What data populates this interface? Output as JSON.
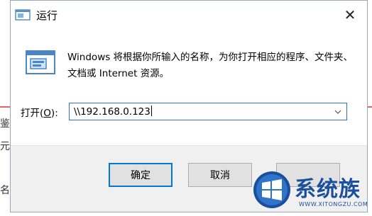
{
  "dialog": {
    "title": "运行",
    "description": "Windows 将根据你所输入的名称，为你打开相应的程序、文件夹、文档或 Internet 资源。",
    "open_label": "打开(",
    "open_label_hotkey": "O",
    "open_label_tail": "):",
    "command_value": "\\\\192.168.0.123",
    "buttons": {
      "ok": "确定",
      "cancel": "取消",
      "browse": ""
    }
  },
  "background": {
    "glyphs": [
      "鉴",
      "元",
      "名"
    ]
  },
  "watermark": {
    "text": "系统族",
    "url": "WWW.XITONGZU.COM"
  },
  "colors": {
    "focus_border": "#0078d7",
    "input_border": "#2f6fd0",
    "watermark": "#1a4f9c",
    "divider": "#d66a6a"
  },
  "icons": {
    "title": "run-app-icon",
    "close": "close-icon",
    "run": "run-program-icon",
    "dropdown": "chevron-down-icon"
  }
}
